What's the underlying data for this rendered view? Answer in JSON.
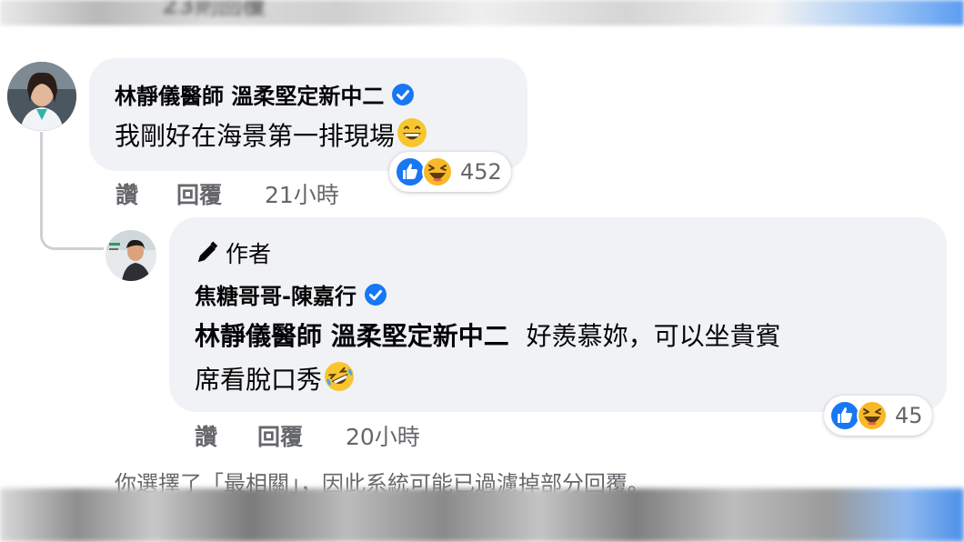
{
  "top_header": {
    "faded_text": "23則回覆"
  },
  "comment": {
    "author": "林靜儀醫師 溫柔堅定新中二",
    "text": "我剛好在海景第一排現場",
    "text_emoji": "grinning-face-emoji",
    "actions": {
      "like": "讚",
      "reply": "回覆",
      "time": "21小時"
    },
    "reactions": {
      "icons": [
        "like-icon",
        "haha-icon"
      ],
      "count": "452"
    }
  },
  "reply": {
    "badge": "作者",
    "badge_icon": "pencil-icon",
    "author": "焦糖哥哥-陳嘉行",
    "mention": "林靜儀醫師 溫柔堅定新中二",
    "text_line1": "好羨慕妳，可以坐貴賓",
    "text_line2": "席看脫口秀",
    "text_emoji": "rolling-laughing-emoji",
    "actions": {
      "like": "讚",
      "reply": "回覆",
      "time": "20小時"
    },
    "reactions": {
      "icons": [
        "like-icon",
        "haha-icon"
      ],
      "count": "45"
    }
  },
  "filter_notice": "你選擇了「最相關」，因此系統可能已過濾掉部分回覆。",
  "colors": {
    "verified_blue": "#1877f2",
    "haha_yellow": "#f7b928",
    "bubble": "#f0f2f5",
    "meta_grey": "#65676b"
  }
}
